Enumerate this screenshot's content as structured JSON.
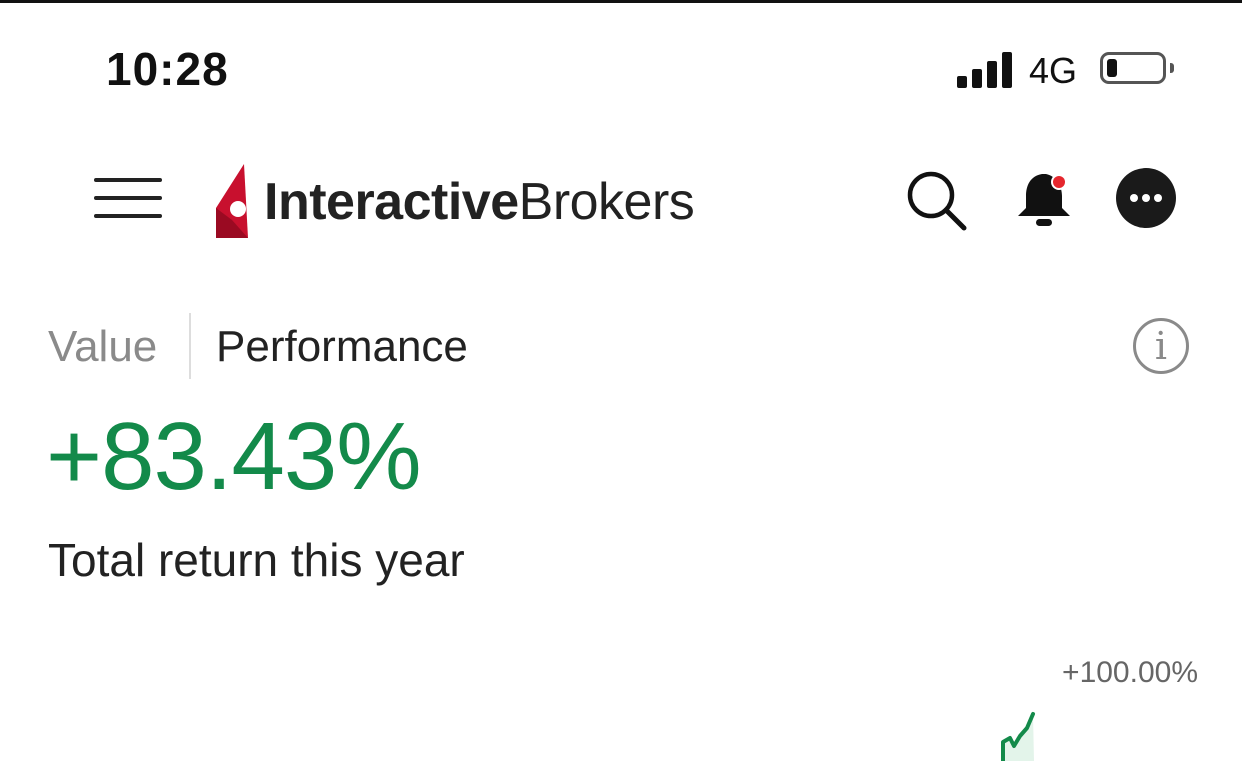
{
  "status_bar": {
    "time": "10:28",
    "network": "4G",
    "battery_level": 0.1,
    "signal_icon": "signal-bars-icon"
  },
  "header": {
    "logo_bold": "Interactive",
    "logo_regular": "Brokers",
    "brand_color": "#c8102e",
    "icons": [
      "menu-icon",
      "search-icon",
      "bell-icon",
      "more-icon"
    ],
    "notification_dot_color": "#e5262d"
  },
  "tabs": [
    {
      "label": "Value",
      "active": false
    },
    {
      "label": "Performance",
      "active": true
    }
  ],
  "performance": {
    "return_value": "+83.43%",
    "return_caption": "Total return this year",
    "positive_color": "#138a4a"
  },
  "chart_data": {
    "type": "line",
    "title": "",
    "xlabel": "",
    "ylabel": "",
    "tick_labels": [
      "+100.00%"
    ],
    "series_color": "#138a4a",
    "note_visible": "partially visible line chart below the fold"
  }
}
